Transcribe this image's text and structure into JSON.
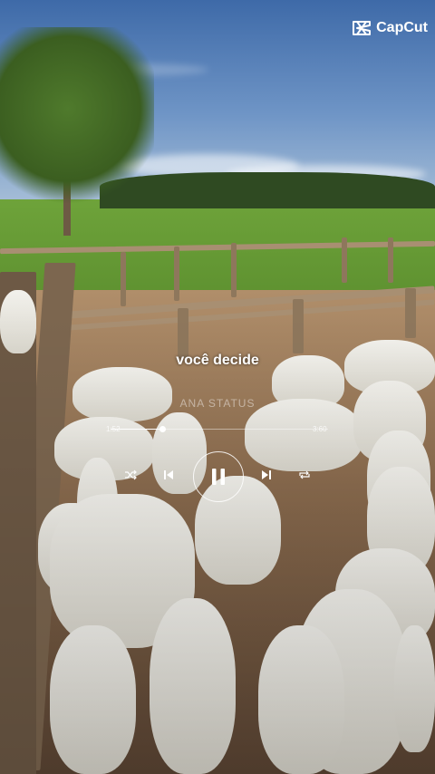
{
  "watermark": {
    "brand": "CapCut",
    "icon": "capcut-logo-icon"
  },
  "player": {
    "lyric": "você decide",
    "artist": "ANA STATUS",
    "time_elapsed": "1:52",
    "time_total": "3:60",
    "progress": 0.24,
    "controls": {
      "shuffle": "shuffle-icon",
      "previous": "skip-previous-icon",
      "play_pause": "pause-icon",
      "next": "skip-next-icon",
      "repeat": "repeat-icon"
    }
  },
  "colors": {
    "text": "#ffffff",
    "accent": "#ffffff"
  }
}
